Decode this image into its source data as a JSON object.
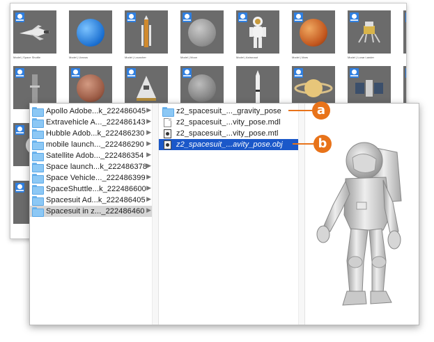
{
  "colors": {
    "accent_orange": "#e8731a",
    "selection_blue": "#1b58c9",
    "folder_blue": "#8cc8f5",
    "badge_blue": "#2f7fe0"
  },
  "thumbnails_top_row": [
    {
      "icon": "space-shuttle-icon",
      "caption": "Model | Space Shuttle"
    },
    {
      "icon": "blue-planet-icon",
      "caption": "Model | Uranus"
    },
    {
      "icon": "rocket-icon",
      "caption": "Model | Launcher"
    },
    {
      "icon": "moon-icon",
      "caption": "Model | Moon"
    },
    {
      "icon": "astronaut-icon",
      "caption": "Model | Astronaut"
    },
    {
      "icon": "mars-planet-icon",
      "caption": "Model | Mars"
    },
    {
      "icon": "lunar-lander-icon",
      "caption": "Model | Lunar Lander"
    },
    {
      "icon": "earth-planet-icon",
      "caption": "Model | Earth"
    }
  ],
  "thumbnails_second_row": [
    {
      "icon": "launch-pad-icon"
    },
    {
      "icon": "red-planet-icon"
    },
    {
      "icon": "capsule-icon"
    },
    {
      "icon": "asteroid-icon"
    },
    {
      "icon": "tall-rocket-icon"
    },
    {
      "icon": "saturn-planet-icon"
    },
    {
      "icon": "satellite-icon"
    },
    {
      "icon": "neptune-planet-icon"
    }
  ],
  "finder": {
    "column1": [
      {
        "name": "Apollo Adobe...k_222486045",
        "selected": false
      },
      {
        "name": "Extravehicle A..._222486143",
        "selected": false
      },
      {
        "name": "Hubble Adob...k_222486230",
        "selected": false
      },
      {
        "name": "mobile launch..._222486290",
        "selected": false
      },
      {
        "name": "Satellite Adob..._222486354",
        "selected": false
      },
      {
        "name": "Space launch...k_222486378",
        "selected": false
      },
      {
        "name": "Space Vehicle..._222486399",
        "selected": false
      },
      {
        "name": "SpaceShuttle...k_222486600",
        "selected": false
      },
      {
        "name": "Spacesuit Ad...k_222486405",
        "selected": false
      },
      {
        "name": "Spacesuit in z..._222486460",
        "selected": true
      }
    ],
    "column2": [
      {
        "name": "z2_spacesuit_..._gravity_pose",
        "kind": "folder",
        "selected": false
      },
      {
        "name": "z2_spacesuit_...vity_pose.mdl",
        "kind": "doc",
        "selected": false
      },
      {
        "name": "z2_spacesuit_...vity_pose.mtl",
        "kind": "objfile",
        "selected": false
      },
      {
        "name": "z2_spacesuit_...avity_pose.obj",
        "kind": "objfile",
        "selected": true
      }
    ],
    "preview_icon": "spacesuit-3d-model-preview"
  },
  "callouts": {
    "a": "a",
    "b": "b"
  }
}
